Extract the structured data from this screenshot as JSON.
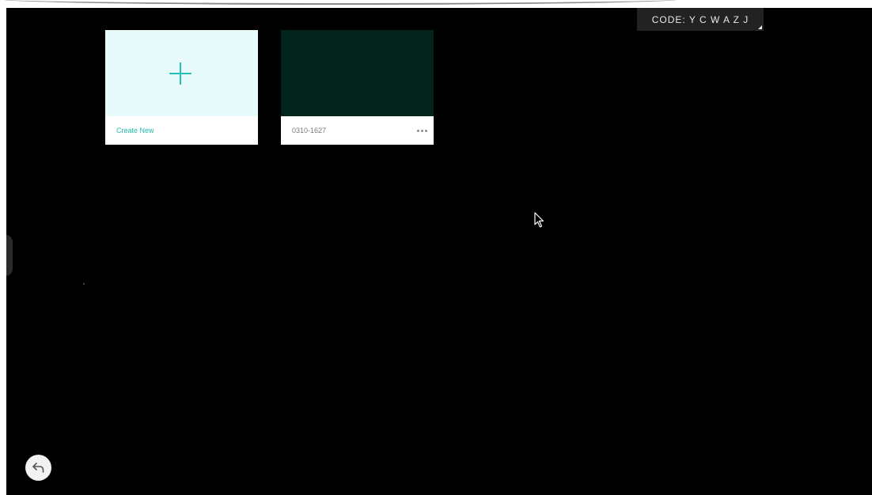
{
  "header": {
    "code_text": "CODE: Y C W A Z J"
  },
  "cards": {
    "create": {
      "label": "Create New",
      "icon": "plus-icon"
    },
    "file": {
      "label": "0310-1627",
      "menu_icon": "more-horizontal-icon"
    }
  },
  "controls": {
    "back_icon": "undo-arrow-icon",
    "side_handle_icon": "chevron-right-icon",
    "cursor_icon": "pointer-cursor-icon"
  },
  "colors": {
    "accent": "#23c0b5",
    "create_thumb_bg": "#e9fafa",
    "file_thumb_bg": "#02221c",
    "canvas_bg": "#000000"
  }
}
